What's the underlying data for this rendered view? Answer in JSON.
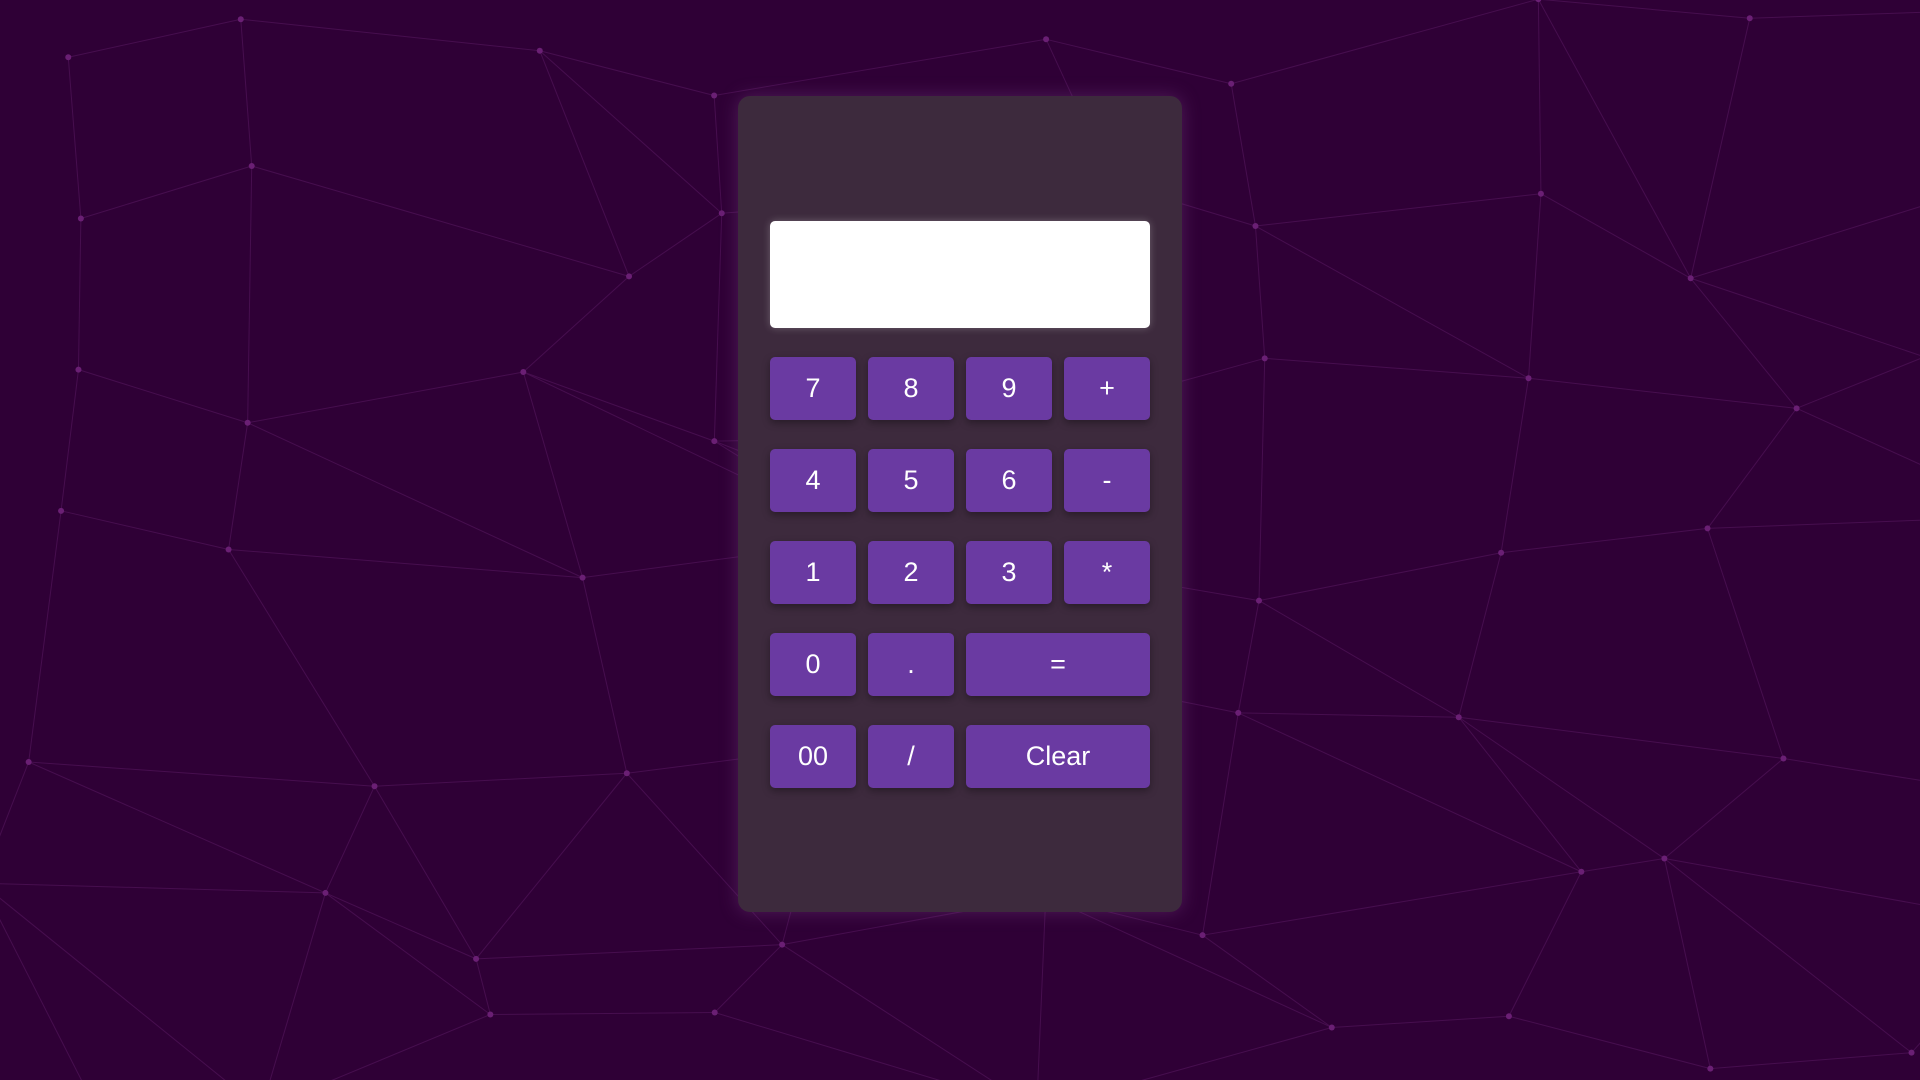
{
  "theme": {
    "background": "#2f0036",
    "card": "#3d2a3d",
    "button": "#6a3aa2",
    "button_text": "#ffffff",
    "display": "#ffffff"
  },
  "display": {
    "value": ""
  },
  "keys": [
    {
      "label": "7",
      "name": "key-7"
    },
    {
      "label": "8",
      "name": "key-8"
    },
    {
      "label": "9",
      "name": "key-9"
    },
    {
      "label": "+",
      "name": "key-plus"
    },
    {
      "label": "4",
      "name": "key-4"
    },
    {
      "label": "5",
      "name": "key-5"
    },
    {
      "label": "6",
      "name": "key-6"
    },
    {
      "label": "-",
      "name": "key-minus"
    },
    {
      "label": "1",
      "name": "key-1"
    },
    {
      "label": "2",
      "name": "key-2"
    },
    {
      "label": "3",
      "name": "key-3"
    },
    {
      "label": "*",
      "name": "key-multiply"
    },
    {
      "label": "0",
      "name": "key-0"
    },
    {
      "label": ".",
      "name": "key-decimal"
    },
    {
      "label": "=",
      "name": "key-equals"
    },
    {
      "label": "00",
      "name": "key-double-zero"
    },
    {
      "label": "/",
      "name": "key-divide"
    },
    {
      "label": "Clear",
      "name": "key-clear"
    }
  ]
}
